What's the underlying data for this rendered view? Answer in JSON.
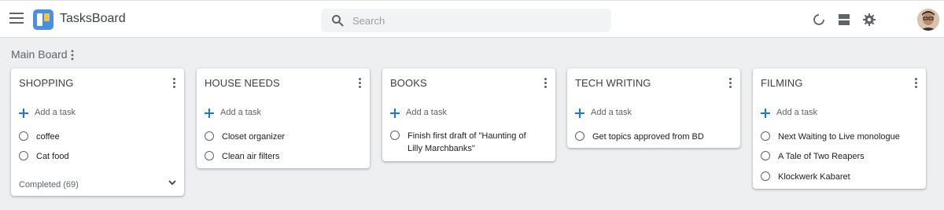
{
  "app": {
    "title": "TasksBoard"
  },
  "search": {
    "placeholder": "Search"
  },
  "board": {
    "title": "Main Board"
  },
  "columns": [
    {
      "title": "SHOPPING",
      "add_label": "Add a task",
      "tasks": [
        "coffee",
        "Cat food"
      ],
      "completed": "Completed (69)"
    },
    {
      "title": "HOUSE NEEDS",
      "add_label": "Add a task",
      "tasks": [
        "Closet organizer",
        "Clean air filters"
      ]
    },
    {
      "title": "BOOKS",
      "add_label": "Add a task",
      "tasks": [
        "Finish first draft of \"Haunting of Lilly Marchbanks\""
      ]
    },
    {
      "title": "TECH WRITING",
      "add_label": "Add a task",
      "tasks": [
        "Get topics approved from BD"
      ]
    },
    {
      "title": "FILMING",
      "add_label": "Add a task",
      "tasks": [
        "Next Waiting to Live monologue",
        "A Tale of Two Reapers",
        "Klockwerk Kabaret"
      ]
    }
  ],
  "icons": {
    "menu": "menu-icon",
    "logo": "tasksboard-logo",
    "search": "search-icon",
    "refresh": "refresh-icon",
    "view": "view-toggle-icon",
    "settings": "gear-icon",
    "avatar": "avatar",
    "add": "plus-icon",
    "task_status": "radio-circle-icon",
    "expand": "chevron-down-icon"
  },
  "colors": {
    "accent": "#1a73e8",
    "logo_blue": "#4a90e2",
    "logo_yellow": "#f6c344",
    "background": "#eeeff1"
  }
}
